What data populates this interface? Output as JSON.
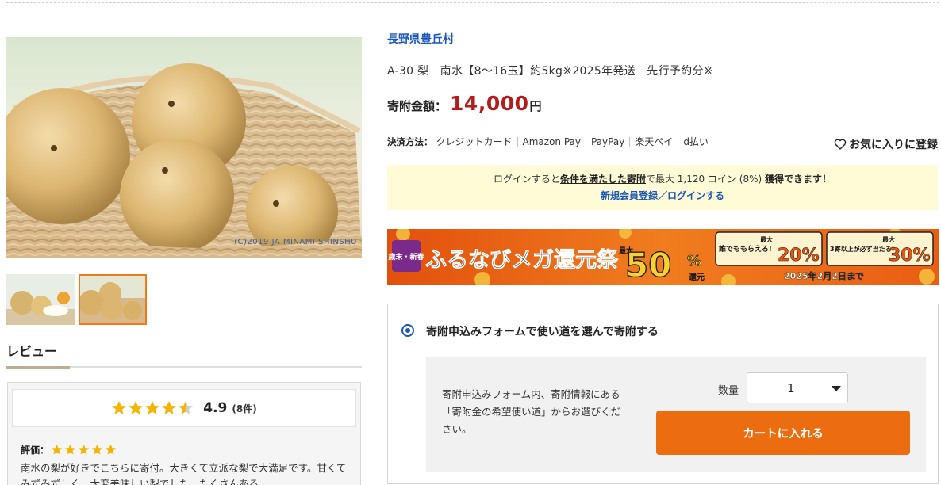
{
  "gallery": {
    "copyright": "(C)2019 JA MINAMI SHINSHU",
    "thumbnails": [
      {
        "label": "thumbnail-1",
        "active": false
      },
      {
        "label": "thumbnail-2",
        "active": true
      }
    ]
  },
  "product": {
    "municipality": "長野県豊丘村",
    "title": "A-30 梨　南水【8～16玉】約5kg※2025年発送　先行予約分※",
    "price_label": "寄附金額",
    "price_colon": "：",
    "price_amount": "14,000",
    "price_unit": "円"
  },
  "payment": {
    "label": "決済方法：",
    "methods": [
      "クレジットカード",
      "Amazon Pay",
      "PayPay",
      "楽天ペイ",
      "d払い"
    ]
  },
  "favorite": {
    "label": "お気に入りに登録",
    "icon": "heart-icon"
  },
  "login_notice": {
    "prefix": "ログインすると",
    "link": "条件を満たした寄附",
    "middle": "で最大 1,120 コイン (8%)",
    "suffix": "獲得できます！",
    "register_link": "新規会員登録／ログインする"
  },
  "banner": {
    "tag": "歳末・新春",
    "main": "ふるなびメガ還元祭",
    "max_label": "最大",
    "percent": "50",
    "percent_sign": "%",
    "return_label": "還元",
    "box1_text": "誰でももらえる!",
    "box1_max": "最大",
    "box1_percent": "20%",
    "box2_text": "3寄以上が必ず当たる!",
    "box2_max": "最大",
    "box2_percent": "30%",
    "date": "2025年2月2日まで"
  },
  "review": {
    "heading": "レビュー",
    "score": "4.9",
    "count": "(8件)",
    "rating_fraction": 0.98,
    "eval_label": "評価：",
    "eval_stars": 5,
    "text": "南水の梨が好きでこちらに寄付。大きくて立派な梨で大満足です。甘くてみずみずしく、大変美味しい梨でした。たくさんある"
  },
  "order_form": {
    "option_title": "寄附申込みフォームで使い道を選んで寄附する",
    "description": "寄附申込みフォーム内、寄附情報にある「寄附金の希望使い道」からお選びください。",
    "qty_label": "数量",
    "qty_value": "1",
    "cart_button": "カートに入れる"
  },
  "colors": {
    "accent_orange": "#ec6d0f",
    "price_red": "#b31c1c",
    "link_blue": "#1a56b8",
    "notice_bg": "#fffbd6",
    "star_gold": "#f5b400"
  }
}
